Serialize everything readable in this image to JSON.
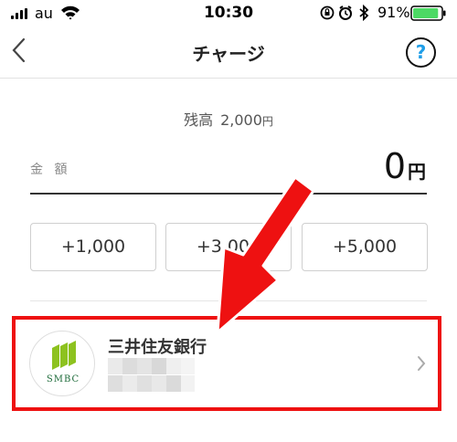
{
  "status_bar": {
    "carrier": "au",
    "time": "10:30",
    "battery": "91%",
    "battery_level": 0.91,
    "icons": [
      "signal-icon",
      "wifi-icon",
      "orientation-lock-icon",
      "alarm-icon",
      "bluetooth-icon",
      "battery-icon"
    ]
  },
  "nav": {
    "title": "チャージ",
    "back_icon": "chevron-left-icon",
    "help_label": "?"
  },
  "balance": {
    "label": "残高",
    "amount": "2,000",
    "unit": "円"
  },
  "amount": {
    "label": "金 額",
    "value": "0",
    "unit": "円"
  },
  "quick_buttons": [
    {
      "label": "+1,000"
    },
    {
      "label": "+3,000"
    },
    {
      "label": "+5,000"
    }
  ],
  "bank": {
    "name": "三井住友銀行",
    "logo_text": "SMBC",
    "chevron": "chevron-right-icon"
  },
  "colors": {
    "accent_red": "#ee1111",
    "help_blue": "#1f9ee8",
    "battery_green": "#4cd964",
    "smbc_green": "#8dc21f"
  }
}
